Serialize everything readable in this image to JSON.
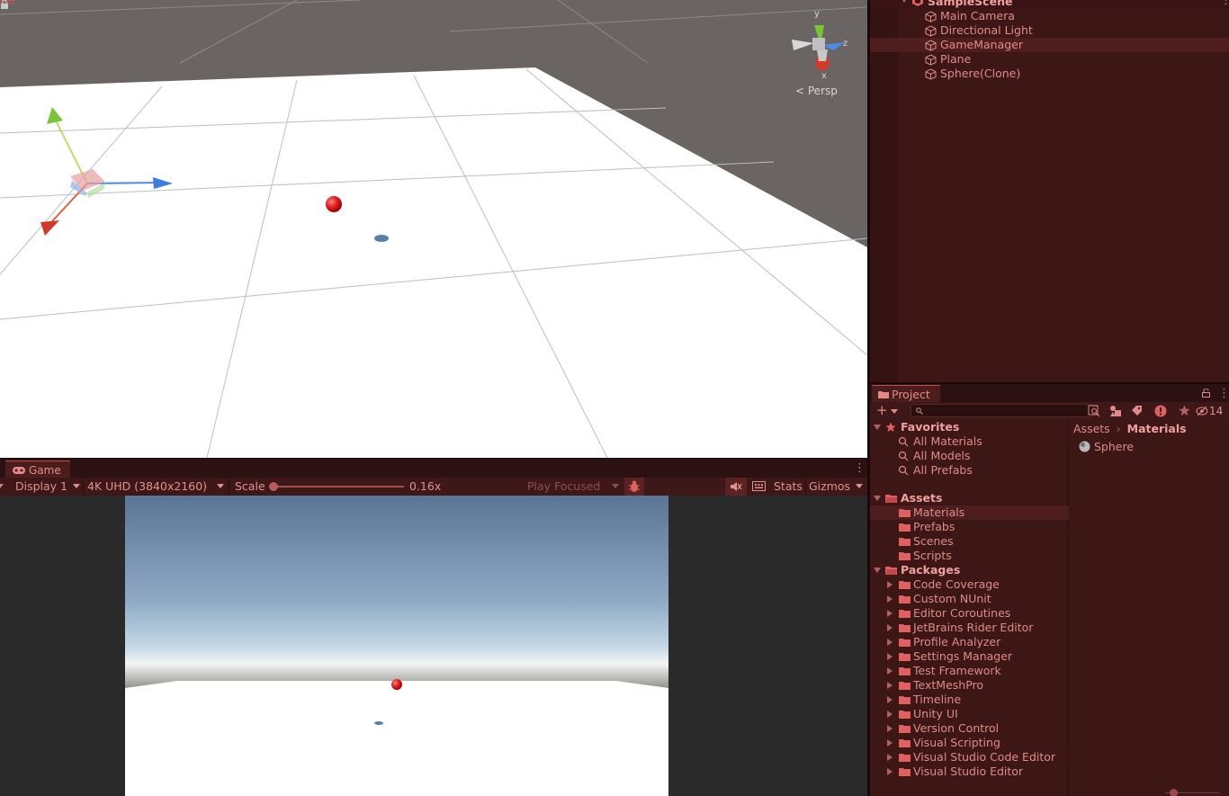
{
  "scene": {
    "persp_label": "Persp",
    "axis_y": "y",
    "axis_z": "z",
    "axis_x": "x"
  },
  "game": {
    "tab_label": "Game",
    "display": "Display 1",
    "resolution": "4K UHD (3840x2160)",
    "scale_label": "Scale",
    "scale_value": "0.16x",
    "play_mode": "Play Focused",
    "stats": "Stats",
    "gizmos": "Gizmos"
  },
  "hierarchy": {
    "scene_name": "SampleScene",
    "items": [
      {
        "label": "Main Camera"
      },
      {
        "label": "Directional Light"
      },
      {
        "label": "GameManager"
      },
      {
        "label": "Plane"
      },
      {
        "label": "Sphere(Clone)"
      }
    ]
  },
  "project": {
    "tab_label": "Project",
    "hidden_count": "14",
    "favorites": {
      "label": "Favorites",
      "items": [
        "All Materials",
        "All Models",
        "All Prefabs"
      ]
    },
    "assets": {
      "label": "Assets",
      "items": [
        "Materials",
        "Prefabs",
        "Scenes",
        "Scripts"
      ]
    },
    "packages": {
      "label": "Packages",
      "items": [
        "Code Coverage",
        "Custom NUnit",
        "Editor Coroutines",
        "JetBrains Rider Editor",
        "Profile Analyzer",
        "Settings Manager",
        "Test Framework",
        "TextMeshPro",
        "Timeline",
        "Unity UI",
        "Version Control",
        "Visual Scripting",
        "Visual Studio Code Editor",
        "Visual Studio Editor"
      ]
    },
    "breadcrumb": {
      "root": "Assets",
      "current": "Materials"
    },
    "content": [
      {
        "label": "Sphere"
      }
    ]
  },
  "colors": {
    "accent": "#e08a8a",
    "panel_bg": "#3d1616",
    "selected_bg": "#4e1e1e"
  }
}
